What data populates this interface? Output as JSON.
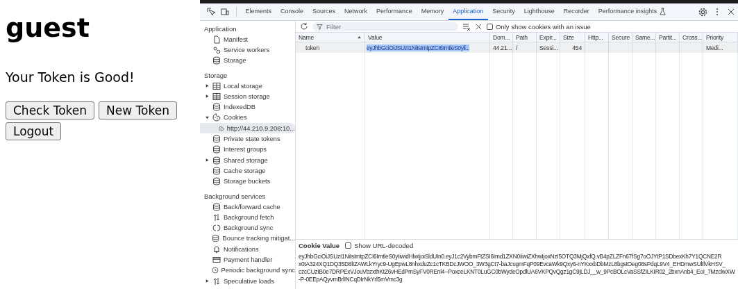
{
  "page": {
    "heading": "guest",
    "message": "Your Token is Good!",
    "buttons": [
      "Check Token",
      "New Token",
      "Logout"
    ]
  },
  "devtools": {
    "tabs": [
      {
        "label": "Elements",
        "selected": false
      },
      {
        "label": "Console",
        "selected": false
      },
      {
        "label": "Sources",
        "selected": false
      },
      {
        "label": "Network",
        "selected": false
      },
      {
        "label": "Performance",
        "selected": false
      },
      {
        "label": "Memory",
        "selected": false
      },
      {
        "label": "Application",
        "selected": true
      },
      {
        "label": "Security",
        "selected": false
      },
      {
        "label": "Lighthouse",
        "selected": false
      },
      {
        "label": "Recorder",
        "selected": false
      },
      {
        "label": "Performance insights",
        "selected": false
      }
    ],
    "sidebar": [
      {
        "title": "Application",
        "items": [
          {
            "label": "Manifest",
            "kind": "file",
            "expandable": false,
            "expanded": false,
            "selected": false
          },
          {
            "label": "Service workers",
            "kind": "gear",
            "expandable": false,
            "expanded": false,
            "selected": false
          },
          {
            "label": "Storage",
            "kind": "database",
            "expandable": false,
            "expanded": false,
            "selected": false
          }
        ]
      },
      {
        "title": "Storage",
        "items": [
          {
            "label": "Local storage",
            "kind": "table",
            "expandable": true,
            "expanded": false,
            "selected": false
          },
          {
            "label": "Session storage",
            "kind": "table",
            "expandable": true,
            "expanded": false,
            "selected": false
          },
          {
            "label": "IndexedDB",
            "kind": "database",
            "expandable": false,
            "expanded": false,
            "selected": false
          },
          {
            "label": "Cookies",
            "kind": "cookie",
            "expandable": true,
            "expanded": true,
            "selected": false,
            "children": [
              {
                "label": "http://44.210.9.208:10...",
                "kind": "cookie",
                "expandable": false,
                "expanded": false,
                "selected": true
              }
            ]
          },
          {
            "label": "Private state tokens",
            "kind": "database",
            "expandable": false,
            "expanded": false,
            "selected": false
          },
          {
            "label": "Interest groups",
            "kind": "database",
            "expandable": false,
            "expanded": false,
            "selected": false
          },
          {
            "label": "Shared storage",
            "kind": "database",
            "expandable": true,
            "expanded": false,
            "selected": false
          },
          {
            "label": "Cache storage",
            "kind": "database",
            "expandable": false,
            "expanded": false,
            "selected": false
          },
          {
            "label": "Storage buckets",
            "kind": "database",
            "expandable": false,
            "expanded": false,
            "selected": false
          }
        ]
      },
      {
        "title": "Background services",
        "items": [
          {
            "label": "Back/forward cache",
            "kind": "database",
            "expandable": false,
            "expanded": false,
            "selected": false
          },
          {
            "label": "Background fetch",
            "kind": "arrows",
            "expandable": false,
            "expanded": false,
            "selected": false
          },
          {
            "label": "Background sync",
            "kind": "sync",
            "expandable": false,
            "expanded": false,
            "selected": false
          },
          {
            "label": "Bounce tracking mitigat...",
            "kind": "database",
            "expandable": false,
            "expanded": false,
            "selected": false
          },
          {
            "label": "Notifications",
            "kind": "bell",
            "expandable": false,
            "expanded": false,
            "selected": false
          },
          {
            "label": "Payment handler",
            "kind": "card",
            "expandable": false,
            "expanded": false,
            "selected": false
          },
          {
            "label": "Periodic background sync",
            "kind": "clock",
            "expandable": false,
            "expanded": false,
            "selected": false
          },
          {
            "label": "Speculative loads",
            "kind": "arrows",
            "expandable": true,
            "expanded": false,
            "selected": false
          }
        ]
      }
    ],
    "toolbar": {
      "filter_placeholder": "Filter",
      "issue_checkbox": {
        "label": "Only show cookies with an issue",
        "checked": false
      }
    },
    "table": {
      "columns": [
        "Name",
        "Value",
        "Dom...",
        "Path",
        "Expir...",
        "Size",
        "Http...",
        "Secure",
        "Same...",
        "Partit...",
        "Cross...",
        "Priority"
      ],
      "rows": [
        {
          "selected": true,
          "cells": [
            "token",
            "eyJhbGciOiJSUzI1NiIsImtpZCI6ImtleS0yli...",
            "44.21...",
            "/",
            "Sessi...",
            "454",
            "",
            "",
            "",
            "",
            "",
            "Medi..."
          ]
        }
      ]
    },
    "cookie_value": {
      "title": "Cookie Value",
      "decode_checkbox": {
        "label": "Show URL-decoded",
        "checked": false
      },
      "lines": [
        "eyJhbGciOiJSUzI1NiIsImtpZCI6ImtleS0yIiwidHlwIjoiSldUIn0.eyJ1c2VybmFtZSI6Imd1ZXN0IiwiZXhwIjoxNzI5OTQ3MjQxfQ.vB4pZLZFn67fSg7oOJYtP1SDbexKh7Y1QCNE2R",
        "x0tA324XQ1DQ35D8lIZAWLkYryc9-UgEpwL8nhxduZc1cTKBDcJWOO_3W3gCt7-baJcugmFqP09EvcaWk9Qxy6-nYKxxbDbMzL8bgstOeg08sPdqL9V4_EHDmwSUltlVkHSV_",
        "czcCUzIB0e7DRPExVJouVbzxthKtZ6vHEdPmSyFV0REnl4--PoxceLKNT0LuGC0bWydeOpdlUA6VKPQvQgz1gC9jLDJ__w_9PcBOLcVaSSfZILKIR02_2bxnAnb4_EoI_7MzclwXW",
        "-P-0EEpAQyvmBrlINCqDIrNkYrl5mVmc3g"
      ]
    }
  }
}
